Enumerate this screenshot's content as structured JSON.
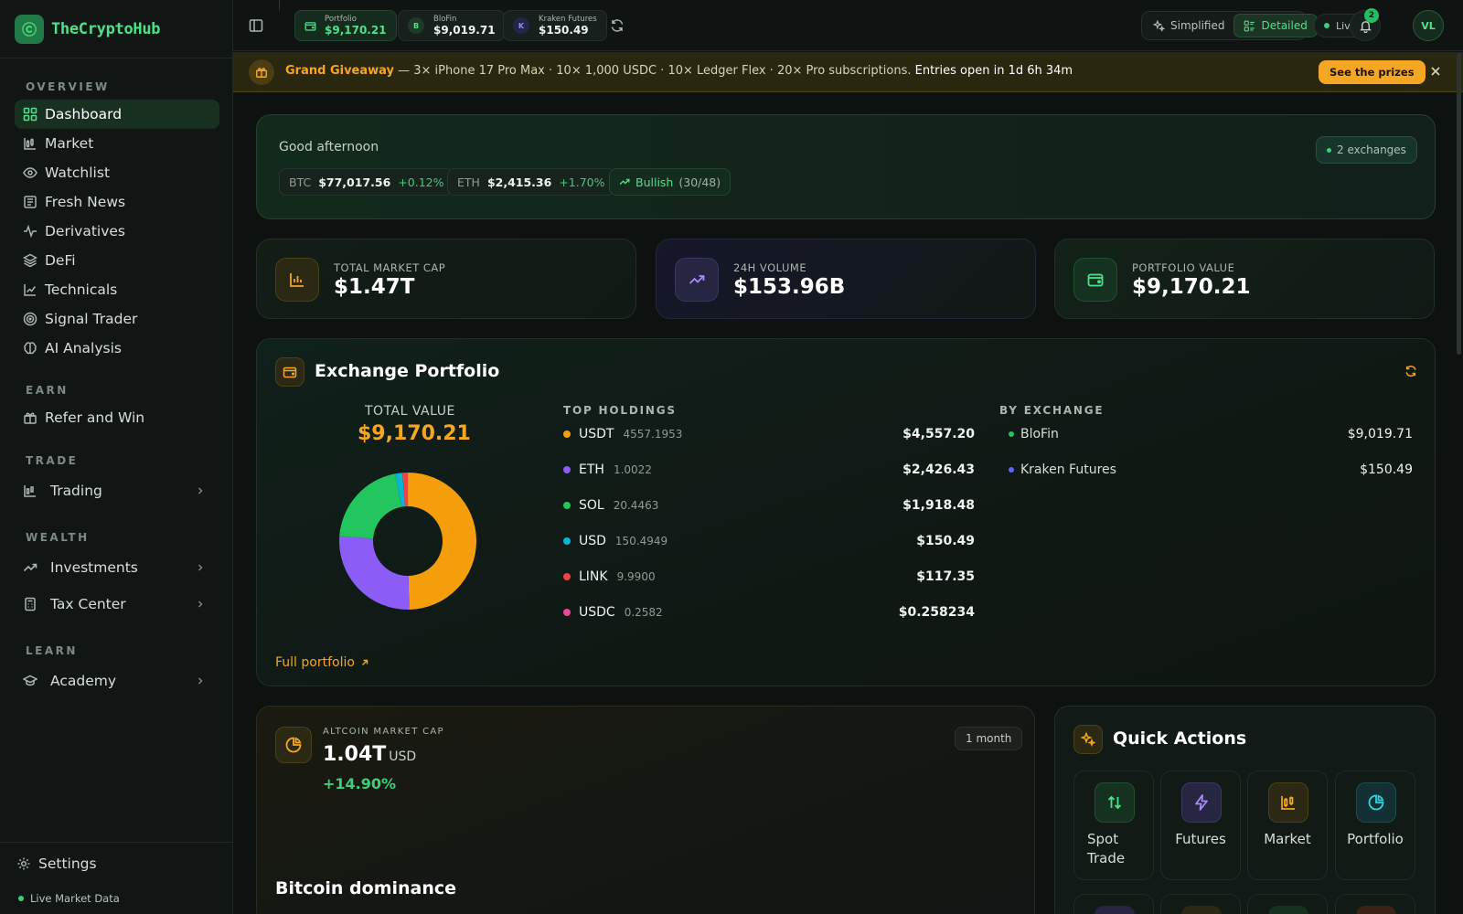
{
  "brand": {
    "name": "TheCryptoHub"
  },
  "sidebar": {
    "sections": {
      "overview": "OVERVIEW",
      "earn": "EARN",
      "trade": "TRADE",
      "wealth": "WEALTH",
      "learn": "LEARN"
    },
    "items": [
      {
        "label": "Dashboard",
        "icon": "grid-icon",
        "active": true
      },
      {
        "label": "Market",
        "icon": "chart-candle-icon"
      },
      {
        "label": "Watchlist",
        "icon": "eye-icon"
      },
      {
        "label": "Fresh News",
        "icon": "newspaper-icon"
      },
      {
        "label": "Derivatives",
        "icon": "pulse-icon"
      },
      {
        "label": "DeFi",
        "icon": "layers-icon"
      },
      {
        "label": "Technicals",
        "icon": "line-chart-icon"
      },
      {
        "label": "Signal Trader",
        "icon": "target-icon"
      },
      {
        "label": "AI Analysis",
        "icon": "brain-icon"
      }
    ],
    "earn_items": [
      {
        "label": "Refer and Win",
        "icon": "gift-icon"
      }
    ],
    "groups": {
      "trading": "Trading",
      "investments": "Investments",
      "tax_center": "Tax Center",
      "academy": "Academy"
    },
    "footer": {
      "settings": "Settings",
      "live_market": "Live Market Data"
    }
  },
  "topbar": {
    "portfolios": [
      {
        "label": "Portfolio",
        "value": "$9,170.21"
      },
      {
        "label": "BloFin",
        "value": "$9,019.71",
        "badge": "B"
      },
      {
        "label": "Kraken Futures",
        "value": "$150.49",
        "badge": "K"
      }
    ],
    "modes": {
      "simplified": "Simplified",
      "detailed": "Detailed",
      "selected": "Detailed"
    },
    "live": "Live",
    "notifications": "2",
    "avatar": "VL"
  },
  "banner": {
    "title": "Grand Giveaway",
    "text": " — 3× iPhone 17 Pro Max · 10× 1,000 USDC · 10× Ledger Flex · 20× Pro subscriptions. ",
    "countdown": "Entries open in 1d 6h 34m",
    "button": "See the prizes"
  },
  "greeting": {
    "title": "Good afternoon",
    "btc": {
      "label": "BTC",
      "value": "$77,017.56",
      "change": "+0.12%"
    },
    "eth": {
      "label": "ETH",
      "value": "$2,415.36",
      "change": "+1.70%"
    },
    "sentiment": {
      "label": "Bullish",
      "count": "(30/48)"
    },
    "exchanges": "2 exchanges"
  },
  "stats": [
    {
      "label": "TOTAL MARKET CAP",
      "value": "$1.47T"
    },
    {
      "label": "24H VOLUME",
      "value": "$153.96B"
    },
    {
      "label": "PORTFOLIO VALUE",
      "value": "$9,170.21"
    }
  ],
  "exchange_portfolio": {
    "title": "Exchange Portfolio",
    "total_label": "TOTAL VALUE",
    "total_value": "$9,170.21",
    "holdings_header": "TOP HOLDINGS",
    "exchange_header": "BY EXCHANGE",
    "holdings": [
      {
        "symbol": "USDT",
        "amount": "4557.1953",
        "usd": "$4,557.20",
        "color": "#f59e0b",
        "share": 49.7
      },
      {
        "symbol": "ETH",
        "amount": "1.0022",
        "usd": "$2,426.43",
        "color": "#8b5cf6",
        "share": 26.46
      },
      {
        "symbol": "SOL",
        "amount": "20.4463",
        "usd": "$1,918.48",
        "color": "#22c55e",
        "share": 20.92
      },
      {
        "symbol": "USD",
        "amount": "150.4949",
        "usd": "$150.49",
        "color": "#06b6d4",
        "share": 1.64
      },
      {
        "symbol": "LINK",
        "amount": "9.9900",
        "usd": "$117.35",
        "color": "#ef4444",
        "share": 1.28
      },
      {
        "symbol": "USDC",
        "amount": "0.2582",
        "usd": "$0.258234",
        "color": "#ec4899",
        "share": 0.003
      }
    ],
    "exchanges": [
      {
        "name": "BloFin",
        "usd": "$9,019.71",
        "color": "#22c55e"
      },
      {
        "name": "Kraken Futures",
        "usd": "$150.49",
        "color": "#6366f1"
      }
    ],
    "full_link": "Full portfolio"
  },
  "altcoin": {
    "label": "ALTCOIN MARKET CAP",
    "value": "1.04T",
    "unit": "USD",
    "change": "+14.90%",
    "period": "1 month",
    "subtitle": "Bitcoin dominance"
  },
  "quick_actions": {
    "title": "Quick Actions",
    "items": [
      {
        "label": "Spot Trade",
        "icon": "arrows-swap-icon"
      },
      {
        "label": "Futures",
        "icon": "bolt-icon"
      },
      {
        "label": "Market",
        "icon": "chart-candle-icon"
      },
      {
        "label": "Portfolio",
        "icon": "pie-icon"
      }
    ]
  },
  "colors": {
    "accent": "#4ee08a",
    "gold": "#f5a623",
    "background": "#0d1210"
  }
}
